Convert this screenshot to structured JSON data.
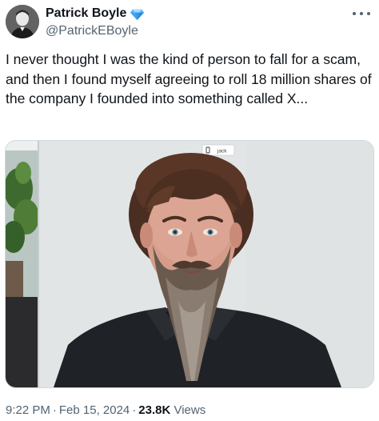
{
  "author": {
    "display_name": "Patrick Boyle",
    "handle": "@PatrickEBoyle",
    "verified_badge": "verified-diamond-icon",
    "badge_color": "#2f9bf0"
  },
  "tweet": {
    "text": "I never thought I was the kind of person to fall for a scam, and then I found myself agreeing to roll 18 million shares of the company I founded into something called X..."
  },
  "media": {
    "overlay_label": "jack"
  },
  "meta": {
    "time": "9:22 PM",
    "separator": "·",
    "date": "Feb 15, 2024",
    "views_count": "23.8K",
    "views_label": "Views"
  },
  "colors": {
    "text_primary": "#0f1419",
    "text_secondary": "#536471",
    "border": "#cfd9de"
  }
}
